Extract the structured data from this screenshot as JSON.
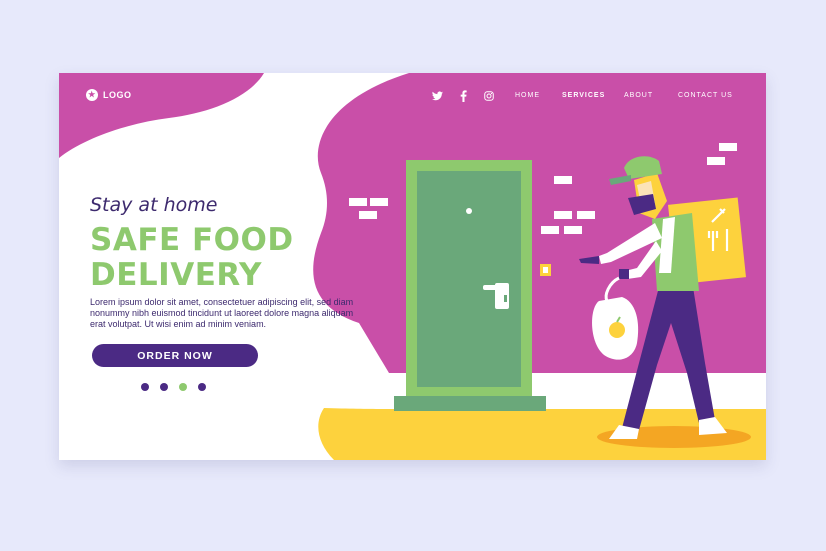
{
  "header": {
    "logo_text": "LOGO",
    "social": [
      "twitter-icon",
      "facebook-icon",
      "instagram-icon"
    ],
    "nav": [
      {
        "label": "HOME",
        "active": false
      },
      {
        "label": "SERVICES",
        "active": true
      },
      {
        "label": "ABOUT",
        "active": false
      },
      {
        "label": "CONTACT US",
        "active": false
      }
    ]
  },
  "hero": {
    "tagline": "Stay at home",
    "headline_line1": "SAFE FOOD",
    "headline_line2": "DELIVERY",
    "body": "Lorem ipsum dolor sit amet, consectetuer adipiscing elit, sed diam nonummy nibh euismod tincidunt ut laoreet dolore magna aliquam erat volutpat. Ut wisi enim ad minim veniam.",
    "cta_label": "ORDER NOW"
  },
  "carousel": {
    "count": 4,
    "active_index": 2
  },
  "colors": {
    "magenta": "#c94fa8",
    "purple": "#4b2a84",
    "green": "#8ec96e",
    "door": "#6aa87a",
    "yellow": "#fdd23d",
    "page_bg": "#e7e9fb"
  }
}
